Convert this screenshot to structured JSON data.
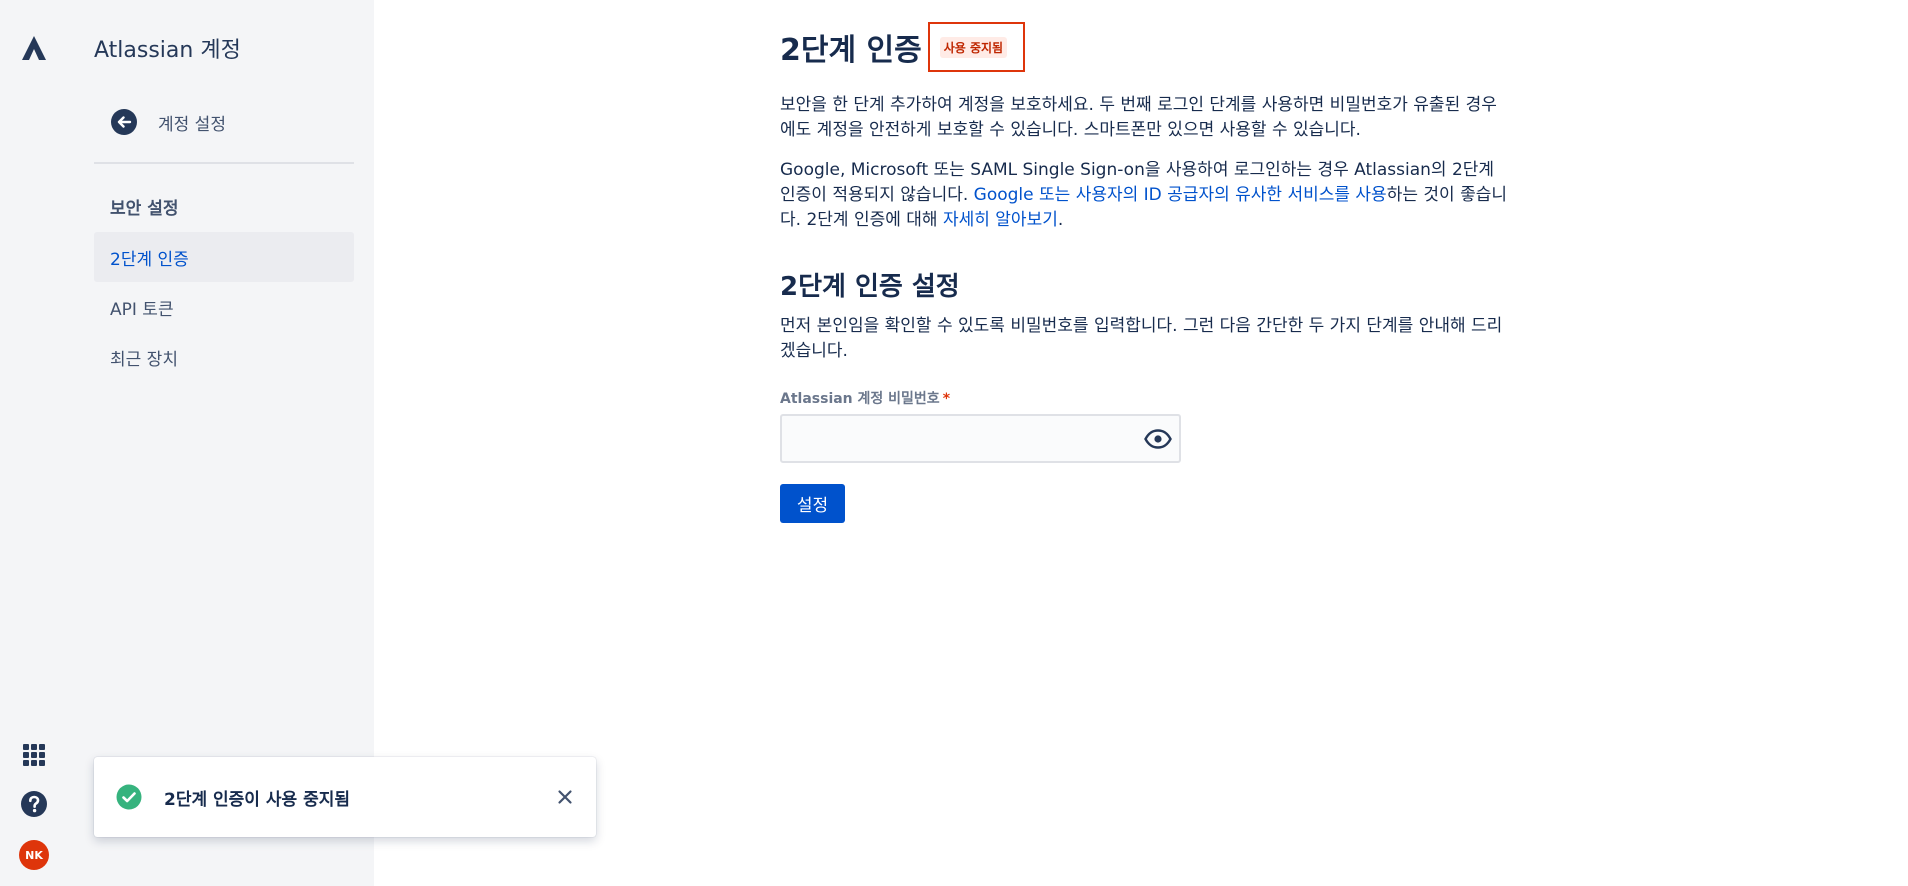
{
  "product": {
    "title": "Atlassian 계정"
  },
  "sidebar": {
    "back_label": "계정 설정",
    "section_heading": "보안 설정",
    "items": [
      {
        "label": "2단계 인증",
        "active": true
      },
      {
        "label": "API 토큰",
        "active": false
      },
      {
        "label": "최근 장치",
        "active": false
      }
    ]
  },
  "global_nav": {
    "avatar_initials": "NK",
    "icons": [
      "atlassian-logo-icon",
      "app-switcher-icon",
      "help-icon"
    ]
  },
  "main": {
    "title": "2단계 인증",
    "status_badge": "사용 중지됨",
    "intro": "보안을 한 단계 추가하여 계정을 보호하세요. 두 번째 로그인 단계를 사용하면 비밀번호가 유출된 경우에도 계정을 안전하게 보호할 수 있습니다. 스마트폰만 있으면 사용할 수 있습니다.",
    "sso_note_before": "Google, Microsoft 또는 SAML Single Sign-on을 사용하여 로그인하는 경우 Atlassian의 2단계 인증이 적용되지 않습니다. ",
    "sso_note_link": "Google 또는 사용자의 ID 공급자의 유사한 서비스를 사용",
    "sso_note_middle": "하는 것이 좋습니다. 2단계 인증에 대해 ",
    "learn_more_link": "자세히 알아보기",
    "sso_note_end": ".",
    "setup_title": "2단계 인증 설정",
    "setup_desc": "먼저 본인임을 확인할 수 있도록 비밀번호를 입력합니다. 그런 다음 간단한 두 가지 단계를 안내해 드리겠습니다.",
    "password_label": "Atlassian 계정 비밀번호",
    "required_mark": "*",
    "password_value": "",
    "submit_label": "설정"
  },
  "toast": {
    "message": "2단계 인증이 사용 중지됨",
    "icon": "check-circle-icon"
  },
  "colors": {
    "brand": "#0052CC",
    "sidebar_bg": "#F4F5F7",
    "danger": "#DE350B",
    "success": "#36B37E",
    "text": "#172B4D"
  }
}
